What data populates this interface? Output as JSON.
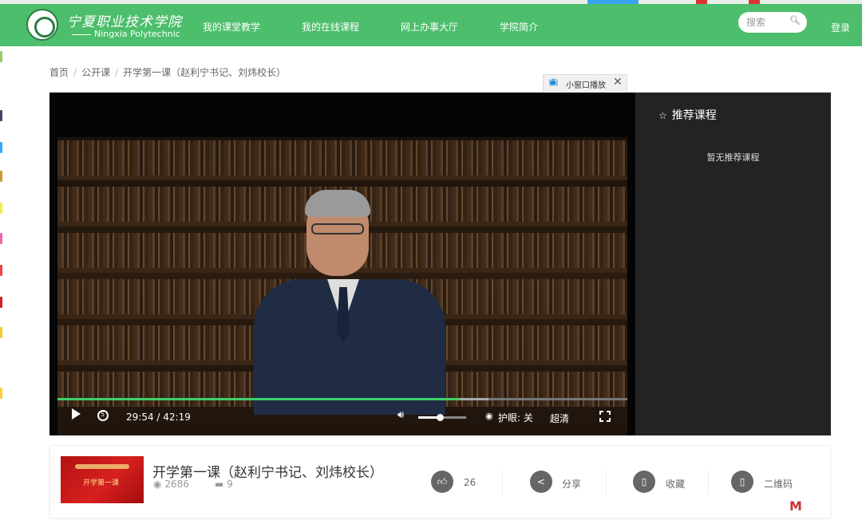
{
  "header": {
    "school_cn": "宁夏职业技术学院",
    "school_en": "Ningxia Polytechnic",
    "nav": [
      "我的课堂教学",
      "我的在线课程",
      "网上办事大厅",
      "学院简介"
    ],
    "search_placeholder": "搜索",
    "login": "登录",
    "bg_color": "#4cbe6c"
  },
  "breadcrumb": {
    "home": "首页",
    "section": "公开课",
    "current": "开学第一课（赵利宁书记、刘炜校长）"
  },
  "player": {
    "mini_window_label": "小窗口播放",
    "time": "29:54 / 42:19",
    "progress_fraction": 0.706,
    "buffered_fraction": 0.757,
    "volume_fraction": 0.45,
    "eye_protection": "护眼: 关",
    "quality": "超清"
  },
  "sidebar": {
    "title": "推荐课程",
    "empty_text": "暂无推荐课程"
  },
  "course": {
    "title": "开学第一课（赵利宁书记、刘炜校长）",
    "views": "2686",
    "comments": "9",
    "thumb_text": "开学第一课",
    "likes": "26",
    "share": "分享",
    "favorite": "收藏",
    "qrcode": "二维码"
  }
}
